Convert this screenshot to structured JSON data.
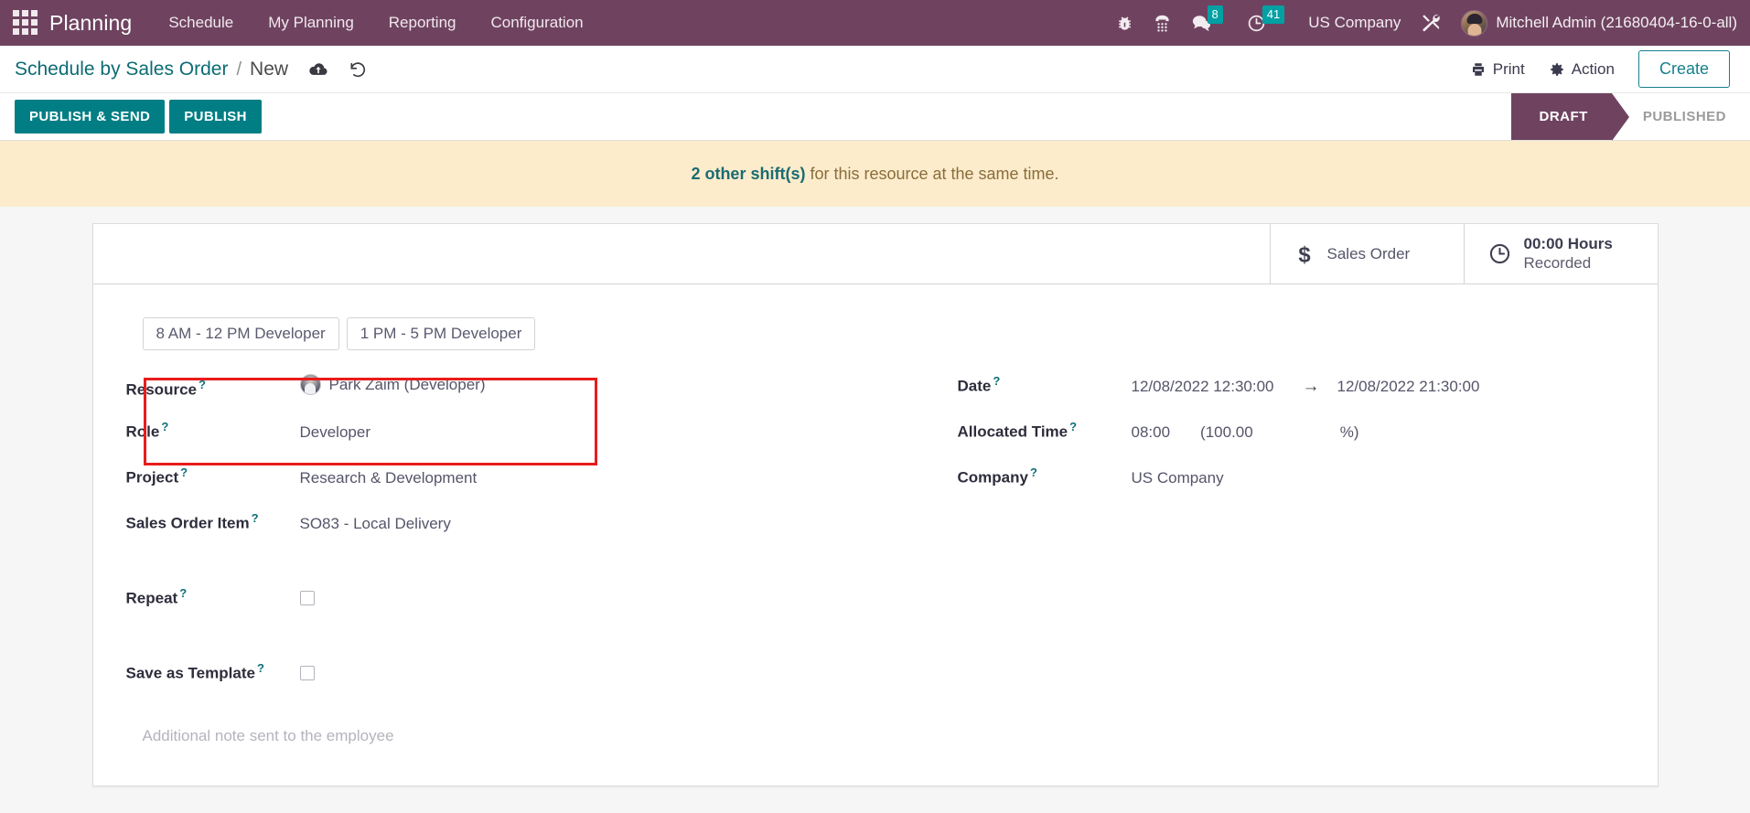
{
  "navbar": {
    "apps_icon": "apps-grid-icon",
    "brand": "Planning",
    "menu": [
      {
        "label": "Schedule"
      },
      {
        "label": "My Planning"
      },
      {
        "label": "Reporting"
      },
      {
        "label": "Configuration"
      }
    ],
    "icons": [
      {
        "name": "bug-icon",
        "glyph": "debug"
      },
      {
        "name": "dialpad-icon",
        "glyph": "phone"
      }
    ],
    "messages": {
      "name": "messages-icon",
      "count": "8"
    },
    "activities": {
      "name": "activities-clock-icon",
      "count": "41"
    },
    "company": "US Company",
    "tools_icon": "tools-icon",
    "user": "Mitchell Admin (21680404-16-0-all)",
    "accent": "#6f4360",
    "badge_color": "#00a0a3"
  },
  "breadcrumb": {
    "root": "Schedule by Sales Order",
    "separator": "/",
    "current": "New",
    "save_icon": "cloud-upload-save-icon",
    "discard_icon": "undo-discard-icon"
  },
  "control_panel": {
    "print_label": "Print",
    "print_icon": "printer-icon",
    "action_label": "Action",
    "action_icon": "gear-icon",
    "create_label": "Create"
  },
  "statusbar": {
    "buttons": [
      {
        "label": "PUBLISH & SEND",
        "name": "publish-and-send-button"
      },
      {
        "label": "PUBLISH",
        "name": "publish-button"
      }
    ],
    "button_color": "#017e84",
    "stages": [
      {
        "label": "DRAFT",
        "active": true
      },
      {
        "label": "PUBLISHED",
        "active": false
      }
    ]
  },
  "alert": {
    "link_text": "2 other shift(s)",
    "rest_text": "for this resource at the same time.",
    "bg": "#fceccc",
    "link_color": "#1b6b72"
  },
  "stat_buttons": [
    {
      "name": "sales-order-stat",
      "icon": "dollar-icon",
      "label": "Sales Order"
    },
    {
      "name": "hours-recorded-stat",
      "icon": "clock-icon",
      "value": "00:00 Hours",
      "label": "Recorded"
    }
  ],
  "templates": [
    {
      "label": "8 AM - 12 PM Developer"
    },
    {
      "label": "1 PM - 5 PM Developer"
    }
  ],
  "form": {
    "left": {
      "resource_label": "Resource",
      "resource_value": "Park Zaim (Developer)",
      "role_label": "Role",
      "role_value": "Developer",
      "project_label": "Project",
      "project_value": "Research & Development",
      "sales_order_item_label": "Sales Order Item",
      "sales_order_item_value": "SO83 - Local Delivery",
      "repeat_label": "Repeat",
      "repeat_checked": false,
      "save_template_label": "Save as Template",
      "save_template_checked": false,
      "note_placeholder": "Additional note sent to the employee"
    },
    "right": {
      "date_label": "Date",
      "date_start": "12/08/2022 12:30:00",
      "date_arrow": "→",
      "date_end": "12/08/2022 21:30:00",
      "allocated_time_label": "Allocated Time",
      "allocated_time_value": "08:00",
      "allocated_percent_open": "(100.00",
      "allocated_percent_close": "%)",
      "company_label": "Company",
      "company_value": "US Company"
    },
    "help_marker": "?",
    "highlight_color": "#e81c1c"
  }
}
